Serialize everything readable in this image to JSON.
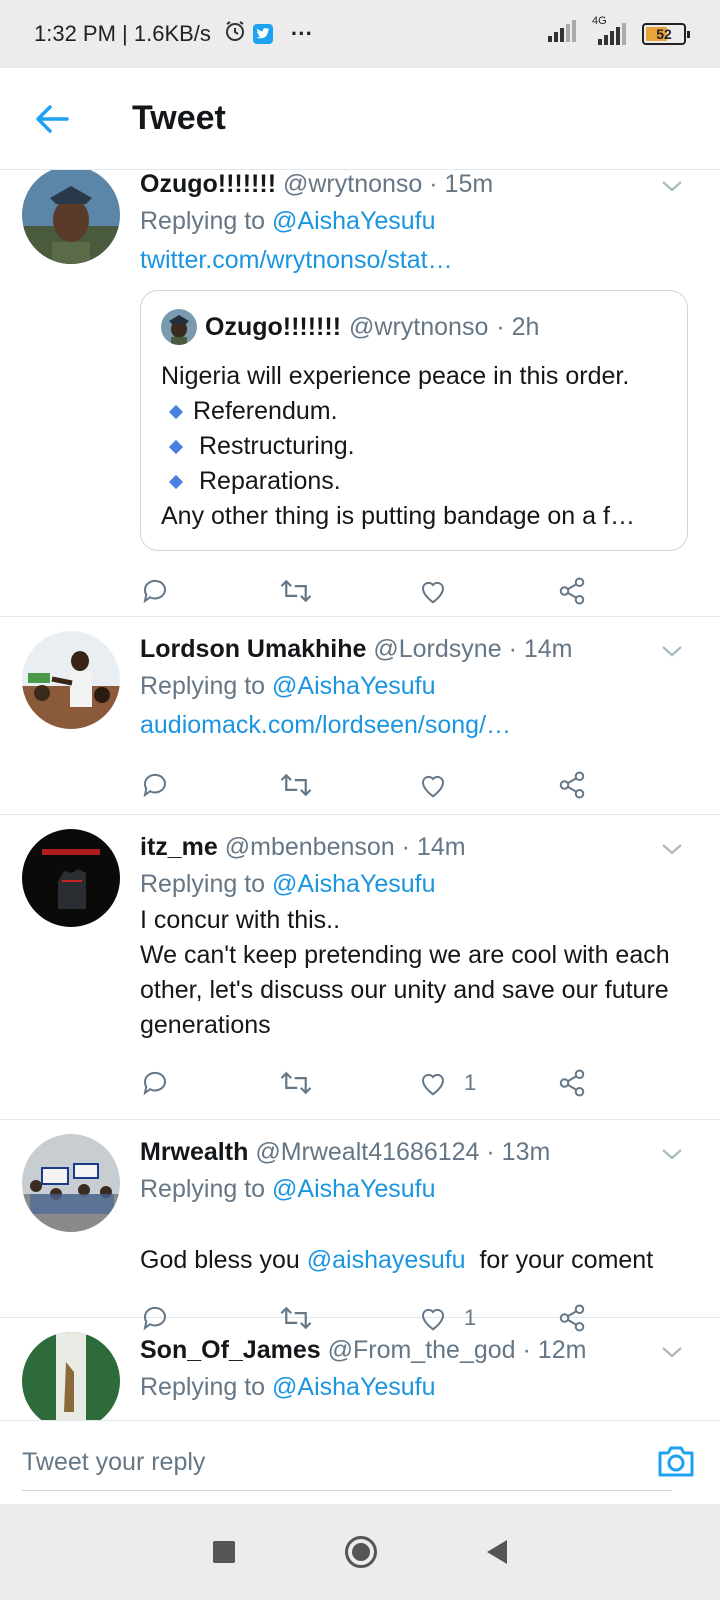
{
  "status_bar": {
    "time_speed": "1:32 PM | 1.6KB/s",
    "network": "4G",
    "battery": "52",
    "more": "···"
  },
  "header": {
    "title": "Tweet"
  },
  "tweets": [
    {
      "name": "Ozugo!!!!!!!",
      "handle": "@wrytnonso",
      "time": "· 15m",
      "replying_prefix": "Replying to",
      "replying_to": "@AishaYesufu",
      "link": "twitter.com/wrytnonso/stat…",
      "quote": {
        "name": "Ozugo!!!!!!!",
        "handle": "@wrytnonso",
        "time": "· 2h",
        "line1": "Nigeria will experience peace in this order.",
        "bullets": [
          "Referendum.",
          "Restructuring.",
          "Reparations."
        ],
        "line_last": "Any other thing is putting bandage on a f…"
      },
      "likes": ""
    },
    {
      "name": "Lordson Umakhihe",
      "handle": "@Lordsyne",
      "time": "· 14m",
      "replying_prefix": "Replying to",
      "replying_to": "@AishaYesufu",
      "link": "audiomack.com/lordseen/song/…",
      "likes": ""
    },
    {
      "name": "itz_me",
      "handle": "@mbenbenson",
      "time": "· 14m",
      "replying_prefix": "Replying to",
      "replying_to": "@AishaYesufu",
      "text": "I concur with this..\nWe can't keep pretending we are cool with each other, let's discuss our unity and save our future generations",
      "likes": "1"
    },
    {
      "name": "Mrwealth",
      "handle": "@Mrwealt41686124",
      "time": "· 13m",
      "replying_prefix": "Replying to",
      "replying_to": "@AishaYesufu",
      "text_before": "God bless you ",
      "mention": "@aishayesufu",
      "text_after": "  for your coment",
      "likes": "1"
    },
    {
      "name": "Son_Of_James",
      "handle": "@From_the_god",
      "time": "· 12m",
      "replying_prefix": "Replying to",
      "replying_to": "@AishaYesufu"
    }
  ],
  "reply_bar": {
    "placeholder": "Tweet your reply"
  },
  "colors": {
    "accent": "#1b95e0",
    "muted": "#657786",
    "text": "#14171a"
  },
  "icons": [
    "back-arrow-icon",
    "reply-icon",
    "retweet-icon",
    "like-icon",
    "share-icon",
    "camera-icon",
    "chevron-down-icon"
  ]
}
